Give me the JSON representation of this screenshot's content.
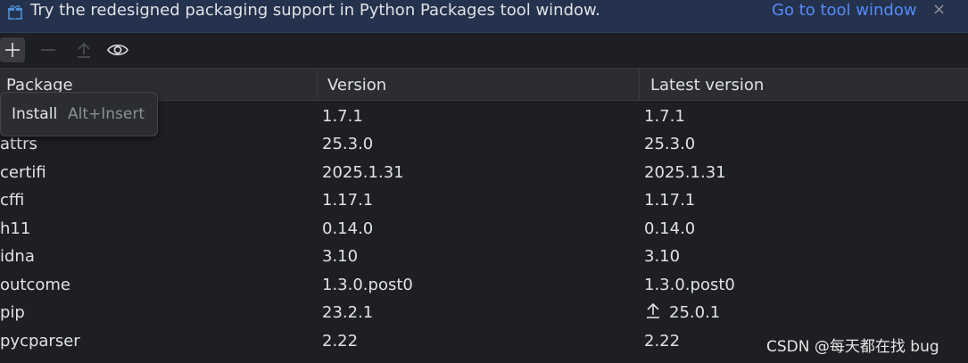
{
  "banner": {
    "icon": "gift-icon",
    "text": "Try the redesigned packaging support in Python Packages tool window.",
    "link": "Go to tool window",
    "close": "×"
  },
  "toolbar": {
    "buttons": [
      "add-icon",
      "remove-icon",
      "upgrade-icon",
      "show-early-releases-icon"
    ]
  },
  "table": {
    "columns": [
      "Package",
      "Version",
      "Latest version"
    ],
    "rows": [
      {
        "package": "",
        "version": "1.7.1",
        "latest": "1.7.1"
      },
      {
        "package": "attrs",
        "version": "25.3.0",
        "latest": "25.3.0"
      },
      {
        "package": "certifi",
        "version": "2025.1.31",
        "latest": "2025.1.31"
      },
      {
        "package": "cffi",
        "version": "1.17.1",
        "latest": "1.17.1"
      },
      {
        "package": "h11",
        "version": "0.14.0",
        "latest": "0.14.0"
      },
      {
        "package": "idna",
        "version": "3.10",
        "latest": "3.10"
      },
      {
        "package": "outcome",
        "version": "1.3.0.post0",
        "latest": "1.3.0.post0"
      },
      {
        "package": "pip",
        "version": "23.2.1",
        "latest": "25.0.1"
      },
      {
        "package": "pycparser",
        "version": "2.22",
        "latest": "2.22"
      }
    ]
  },
  "popup": {
    "label": "Install",
    "shortcut": "Alt+Insert"
  },
  "watermark": "CSDN @每天都在找 bug",
  "colors": {
    "background": "#1e1f22",
    "banner": "#25324d",
    "link": "#548af7",
    "header": "#2b2d30"
  }
}
